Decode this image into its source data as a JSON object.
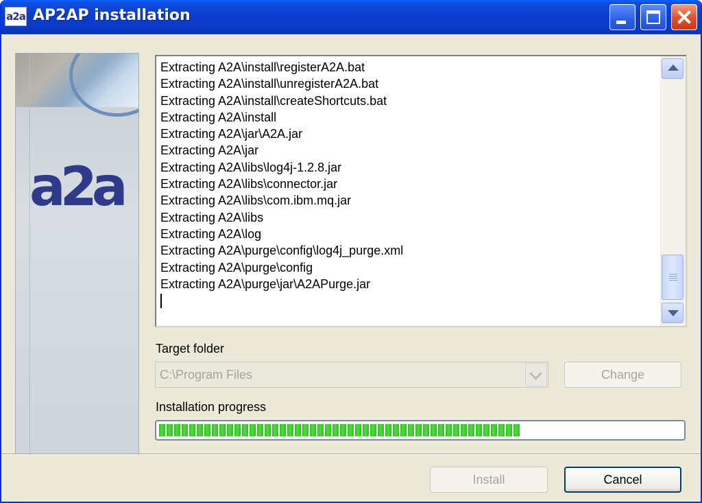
{
  "window": {
    "title": "AP2AP installation",
    "icon_text": "a2a"
  },
  "banner": {
    "logo_text": "a2a"
  },
  "log": {
    "lines": [
      "Extracting A2A\\install\\registerA2A.bat",
      "Extracting A2A\\install\\unregisterA2A.bat",
      "Extracting A2A\\install\\createShortcuts.bat",
      "Extracting A2A\\install",
      "Extracting A2A\\jar\\A2A.jar",
      "Extracting A2A\\jar",
      "Extracting A2A\\libs\\log4j-1.2.8.jar",
      "Extracting A2A\\libs\\connector.jar",
      "Extracting A2A\\libs\\com.ibm.mq.jar",
      "Extracting A2A\\libs",
      "Extracting A2A\\log",
      "Extracting A2A\\purge\\config\\log4j_purge.xml",
      "Extracting A2A\\purge\\config",
      "Extracting A2A\\purge\\jar\\A2APurge.jar"
    ]
  },
  "target_folder": {
    "label": "Target folder",
    "value": "C:\\Program Files",
    "change_label": "Change"
  },
  "progress": {
    "label": "Installation progress",
    "percent": 69
  },
  "buttons": {
    "install_label": "Install",
    "cancel_label": "Cancel"
  },
  "colors": {
    "title_bar": "#0a3ac9",
    "progress_green": "#2fc11f",
    "window_bg": "#ece9d8"
  }
}
